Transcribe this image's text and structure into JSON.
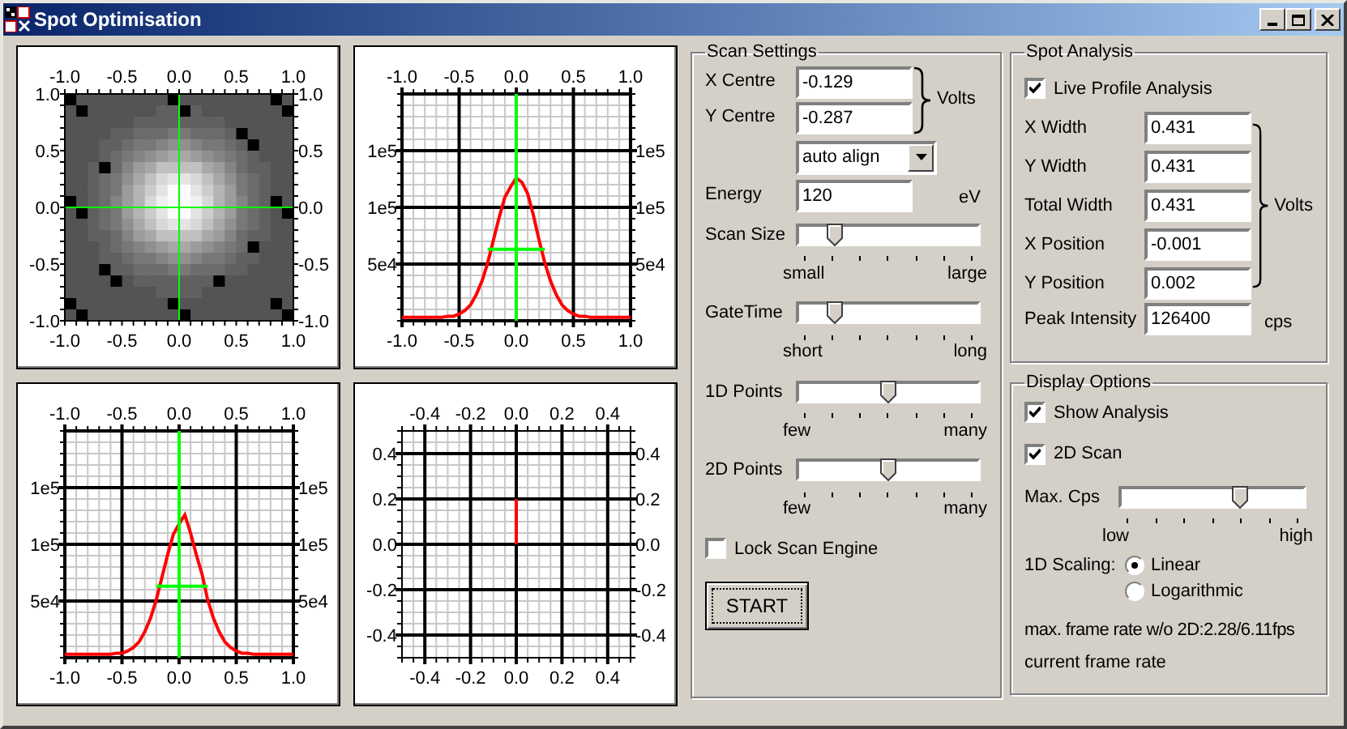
{
  "window": {
    "title": "Spot Optimisation"
  },
  "plots": [
    {
      "kind": "heatmap",
      "top_axis_labels": [
        "-1.0",
        "-0.5",
        "0.0",
        "0.5",
        "1.0"
      ],
      "left_axis_labels": [
        "1.0",
        "0.5",
        "0.0",
        "-0.5",
        "-1.0"
      ],
      "right_axis_labels": [
        "1.0",
        "0.5",
        "0.0",
        "-0.5",
        "-1.0"
      ],
      "bottom_axis_labels": [
        "-1.0",
        "-0.5",
        "0.0",
        "0.5",
        "1.0"
      ]
    },
    {
      "kind": "profile",
      "top_axis_labels": [
        "-1.0",
        "-0.5",
        "0.0",
        "0.5",
        "1.0"
      ],
      "right_axis_labels": [
        "1e5",
        "1e5",
        "5e4"
      ],
      "chart_data": {
        "type": "line",
        "grid": true,
        "xlim": [
          -1,
          1
        ],
        "ylim": [
          0,
          200000
        ],
        "xticks": [
          {
            "value": -1,
            "label": "-1.0"
          },
          {
            "value": -0.5,
            "label": "-0.5"
          },
          {
            "value": 0,
            "label": "0.0"
          },
          {
            "value": 0.5,
            "label": "0.5"
          },
          {
            "value": 1,
            "label": "1.0"
          }
        ],
        "yticks": [
          {
            "value": 150000,
            "label": "1e5"
          },
          {
            "value": 100000,
            "label": "1e5"
          },
          {
            "value": 50000,
            "label": "5e4"
          }
        ],
        "x": [
          -1,
          -0.95,
          -0.9,
          -0.85,
          -0.8,
          -0.75,
          -0.7,
          -0.65,
          -0.6,
          -0.55,
          -0.5,
          -0.45,
          -0.4,
          -0.35,
          -0.3,
          -0.25,
          -0.2,
          -0.15,
          -0.1,
          -0.05,
          0,
          0.05,
          0.1,
          0.15,
          0.2,
          0.25,
          0.3,
          0.35,
          0.4,
          0.45,
          0.5,
          0.55,
          0.6,
          0.65,
          0.7,
          0.75,
          0.8,
          0.85,
          0.9,
          0.95,
          1
        ],
        "series": [
          {
            "color": "#ff0000",
            "values": [
              3000,
              3000,
              3000,
              3000,
              3000,
              3000,
              3000,
              3000,
              4000,
              4000,
              6000,
              9000,
              14000,
              23000,
              35000,
              51000,
              71000,
              91000,
              109000,
              118000,
              126000,
              122000,
              112000,
              93000,
              71000,
              51000,
              35000,
              23000,
              14000,
              9000,
              6000,
              4000,
              4000,
              3000,
              3000,
              3000,
              3000,
              3000,
              3000,
              3000,
              3000
            ]
          }
        ],
        "ref_lines": [
          {
            "axis": "x",
            "value": 0,
            "color": "#00ff00"
          }
        ]
      }
    },
    {
      "kind": "profile",
      "top_axis_labels": [
        "-1.0",
        "-0.5",
        "0.0",
        "0.5",
        "1.0"
      ],
      "right_axis_labels": [
        "1e5",
        "1e5",
        "5e4"
      ],
      "chart_data": {
        "type": "line",
        "grid": true,
        "xlim": [
          -1,
          1
        ],
        "ylim": [
          0,
          200000
        ],
        "xticks": [
          {
            "value": -1,
            "label": "-1.0"
          },
          {
            "value": -0.5,
            "label": "-0.5"
          },
          {
            "value": 0,
            "label": "0.0"
          },
          {
            "value": 0.5,
            "label": "0.5"
          },
          {
            "value": 1,
            "label": "1.0"
          }
        ],
        "yticks": [
          {
            "value": 150000,
            "label": "1e5"
          },
          {
            "value": 100000,
            "label": "1e5"
          },
          {
            "value": 50000,
            "label": "5e4"
          }
        ],
        "x": [
          -1,
          -0.95,
          -0.9,
          -0.85,
          -0.8,
          -0.75,
          -0.7,
          -0.65,
          -0.6,
          -0.55,
          -0.5,
          -0.45,
          -0.4,
          -0.35,
          -0.3,
          -0.25,
          -0.2,
          -0.15,
          -0.1,
          -0.05,
          0,
          0.05,
          0.1,
          0.15,
          0.2,
          0.25,
          0.3,
          0.35,
          0.4,
          0.45,
          0.5,
          0.55,
          0.6,
          0.65,
          0.7,
          0.75,
          0.8,
          0.85,
          0.9,
          0.95,
          1
        ],
        "series": [
          {
            "color": "#ff0000",
            "values": [
              3000,
              3000,
              3000,
              3000,
              3000,
              3000,
              3000,
              3000,
              3000,
              4000,
              4000,
              6000,
              9000,
              14000,
              23000,
              35000,
              51000,
              71000,
              91000,
              109000,
              118000,
              126000,
              110000,
              91000,
              74000,
              51000,
              35000,
              23000,
              14000,
              9000,
              6000,
              4000,
              4000,
              3000,
              3000,
              3000,
              3000,
              3000,
              3000,
              3000,
              3000
            ]
          }
        ],
        "ref_lines": [
          {
            "axis": "x",
            "value": 0,
            "color": "#00ff00"
          }
        ]
      }
    },
    {
      "kind": "position",
      "top_axis_labels": [
        "-0.4",
        "-0.2",
        "0.0",
        "0.2",
        "0.4"
      ],
      "right_axis_labels": [
        "0.4",
        "0.2",
        "0.0",
        "-0.2",
        "-0.4"
      ],
      "chart_data": {
        "type": "line",
        "grid": true,
        "xlim": [
          -0.5,
          0.5
        ],
        "ylim": [
          -0.5,
          0.5
        ],
        "xticks": [
          {
            "value": -0.4,
            "label": "-0.4"
          },
          {
            "value": -0.2,
            "label": "-0.2"
          },
          {
            "value": 0,
            "label": "0.0"
          },
          {
            "value": 0.2,
            "label": "0.2"
          },
          {
            "value": 0.4,
            "label": "0.4"
          }
        ],
        "yticks": [
          {
            "value": 0.4,
            "label": "0.4"
          },
          {
            "value": 0.2,
            "label": "0.2"
          },
          {
            "value": 0,
            "label": "0.0"
          },
          {
            "value": -0.2,
            "label": "-0.2"
          },
          {
            "value": -0.4,
            "label": "-0.4"
          }
        ],
        "x": [
          0,
          0
        ],
        "series": [
          {
            "color": "#ff0000",
            "values": [
              0,
              0.2
            ]
          }
        ]
      }
    }
  ],
  "scan_settings": {
    "title": "Scan Settings",
    "x_centre": {
      "label": "X Centre",
      "value": "-0.129"
    },
    "y_centre": {
      "label": "Y Centre",
      "value": "-0.287"
    },
    "centre_unit": "Volts",
    "align_mode": "auto align",
    "energy": {
      "label": "Energy",
      "value": "120",
      "unit": "eV"
    },
    "sliders": [
      {
        "label": "Scan Size",
        "min_label": "small",
        "max_label": "large",
        "level": 0.167
      },
      {
        "label": "GateTime",
        "min_label": "short",
        "max_label": "long",
        "level": 0.167
      },
      {
        "label": "1D Points",
        "min_label": "few",
        "max_label": "many",
        "level": 0.5
      },
      {
        "label": "2D Points",
        "min_label": "few",
        "max_label": "many",
        "level": 0.5
      }
    ],
    "lock": {
      "label": "Lock Scan Engine",
      "checked": false
    },
    "start_button": "START"
  },
  "spot_analysis": {
    "title": "Spot Analysis",
    "live_profile": {
      "label": "Live Profile Analysis",
      "checked": true
    },
    "fields": [
      {
        "label": "X Width",
        "value": "0.431"
      },
      {
        "label": "Y Width",
        "value": "0.431"
      },
      {
        "label": "Total Width",
        "value": "0.431"
      },
      {
        "label": "X Position",
        "value": "-0.001"
      },
      {
        "label": "Y Position",
        "value": "0.002"
      }
    ],
    "unit": "Volts",
    "peak": {
      "label": "Peak Intensity",
      "value": "126400",
      "unit": "cps"
    }
  },
  "display_options": {
    "title": "Display Options",
    "checkboxes": [
      {
        "label": "Show Analysis",
        "checked": true
      },
      {
        "label": "2D Scan",
        "checked": true
      }
    ],
    "max_cps": {
      "label": "Max. Cps",
      "min_label": "low",
      "max_label": "high",
      "level": 0.667
    },
    "scaling": {
      "label": "1D Scaling:",
      "options": [
        {
          "label": "Linear",
          "selected": true
        },
        {
          "label": "Logarithmic",
          "selected": false
        }
      ]
    },
    "frame_rate_max": "max. frame rate w/o 2D:2.28/6.11fps",
    "frame_rate_current": "current frame rate"
  }
}
